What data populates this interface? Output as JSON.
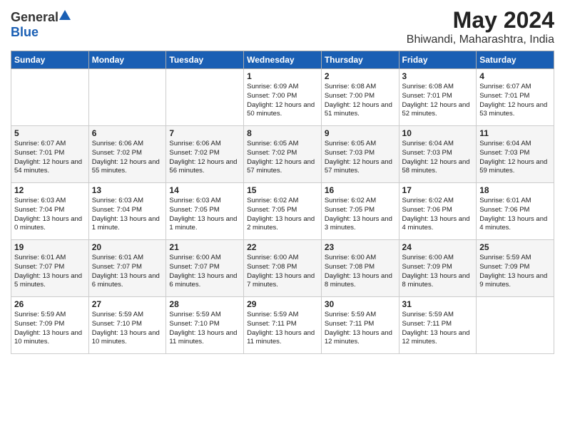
{
  "header": {
    "logo_general": "General",
    "logo_blue": "Blue",
    "title": "May 2024",
    "subtitle": "Bhiwandi, Maharashtra, India"
  },
  "days_of_week": [
    "Sunday",
    "Monday",
    "Tuesday",
    "Wednesday",
    "Thursday",
    "Friday",
    "Saturday"
  ],
  "weeks": [
    [
      {
        "day": "",
        "info": ""
      },
      {
        "day": "",
        "info": ""
      },
      {
        "day": "",
        "info": ""
      },
      {
        "day": "1",
        "info": "Sunrise: 6:09 AM\nSunset: 7:00 PM\nDaylight: 12 hours\nand 50 minutes."
      },
      {
        "day": "2",
        "info": "Sunrise: 6:08 AM\nSunset: 7:00 PM\nDaylight: 12 hours\nand 51 minutes."
      },
      {
        "day": "3",
        "info": "Sunrise: 6:08 AM\nSunset: 7:01 PM\nDaylight: 12 hours\nand 52 minutes."
      },
      {
        "day": "4",
        "info": "Sunrise: 6:07 AM\nSunset: 7:01 PM\nDaylight: 12 hours\nand 53 minutes."
      }
    ],
    [
      {
        "day": "5",
        "info": "Sunrise: 6:07 AM\nSunset: 7:01 PM\nDaylight: 12 hours\nand 54 minutes."
      },
      {
        "day": "6",
        "info": "Sunrise: 6:06 AM\nSunset: 7:02 PM\nDaylight: 12 hours\nand 55 minutes."
      },
      {
        "day": "7",
        "info": "Sunrise: 6:06 AM\nSunset: 7:02 PM\nDaylight: 12 hours\nand 56 minutes."
      },
      {
        "day": "8",
        "info": "Sunrise: 6:05 AM\nSunset: 7:02 PM\nDaylight: 12 hours\nand 57 minutes."
      },
      {
        "day": "9",
        "info": "Sunrise: 6:05 AM\nSunset: 7:03 PM\nDaylight: 12 hours\nand 57 minutes."
      },
      {
        "day": "10",
        "info": "Sunrise: 6:04 AM\nSunset: 7:03 PM\nDaylight: 12 hours\nand 58 minutes."
      },
      {
        "day": "11",
        "info": "Sunrise: 6:04 AM\nSunset: 7:03 PM\nDaylight: 12 hours\nand 59 minutes."
      }
    ],
    [
      {
        "day": "12",
        "info": "Sunrise: 6:03 AM\nSunset: 7:04 PM\nDaylight: 13 hours\nand 0 minutes."
      },
      {
        "day": "13",
        "info": "Sunrise: 6:03 AM\nSunset: 7:04 PM\nDaylight: 13 hours\nand 1 minute."
      },
      {
        "day": "14",
        "info": "Sunrise: 6:03 AM\nSunset: 7:05 PM\nDaylight: 13 hours\nand 1 minute."
      },
      {
        "day": "15",
        "info": "Sunrise: 6:02 AM\nSunset: 7:05 PM\nDaylight: 13 hours\nand 2 minutes."
      },
      {
        "day": "16",
        "info": "Sunrise: 6:02 AM\nSunset: 7:05 PM\nDaylight: 13 hours\nand 3 minutes."
      },
      {
        "day": "17",
        "info": "Sunrise: 6:02 AM\nSunset: 7:06 PM\nDaylight: 13 hours\nand 4 minutes."
      },
      {
        "day": "18",
        "info": "Sunrise: 6:01 AM\nSunset: 7:06 PM\nDaylight: 13 hours\nand 4 minutes."
      }
    ],
    [
      {
        "day": "19",
        "info": "Sunrise: 6:01 AM\nSunset: 7:07 PM\nDaylight: 13 hours\nand 5 minutes."
      },
      {
        "day": "20",
        "info": "Sunrise: 6:01 AM\nSunset: 7:07 PM\nDaylight: 13 hours\nand 6 minutes."
      },
      {
        "day": "21",
        "info": "Sunrise: 6:00 AM\nSunset: 7:07 PM\nDaylight: 13 hours\nand 6 minutes."
      },
      {
        "day": "22",
        "info": "Sunrise: 6:00 AM\nSunset: 7:08 PM\nDaylight: 13 hours\nand 7 minutes."
      },
      {
        "day": "23",
        "info": "Sunrise: 6:00 AM\nSunset: 7:08 PM\nDaylight: 13 hours\nand 8 minutes."
      },
      {
        "day": "24",
        "info": "Sunrise: 6:00 AM\nSunset: 7:09 PM\nDaylight: 13 hours\nand 8 minutes."
      },
      {
        "day": "25",
        "info": "Sunrise: 5:59 AM\nSunset: 7:09 PM\nDaylight: 13 hours\nand 9 minutes."
      }
    ],
    [
      {
        "day": "26",
        "info": "Sunrise: 5:59 AM\nSunset: 7:09 PM\nDaylight: 13 hours\nand 10 minutes."
      },
      {
        "day": "27",
        "info": "Sunrise: 5:59 AM\nSunset: 7:10 PM\nDaylight: 13 hours\nand 10 minutes."
      },
      {
        "day": "28",
        "info": "Sunrise: 5:59 AM\nSunset: 7:10 PM\nDaylight: 13 hours\nand 11 minutes."
      },
      {
        "day": "29",
        "info": "Sunrise: 5:59 AM\nSunset: 7:11 PM\nDaylight: 13 hours\nand 11 minutes."
      },
      {
        "day": "30",
        "info": "Sunrise: 5:59 AM\nSunset: 7:11 PM\nDaylight: 13 hours\nand 12 minutes."
      },
      {
        "day": "31",
        "info": "Sunrise: 5:59 AM\nSunset: 7:11 PM\nDaylight: 13 hours\nand 12 minutes."
      },
      {
        "day": "",
        "info": ""
      }
    ]
  ]
}
